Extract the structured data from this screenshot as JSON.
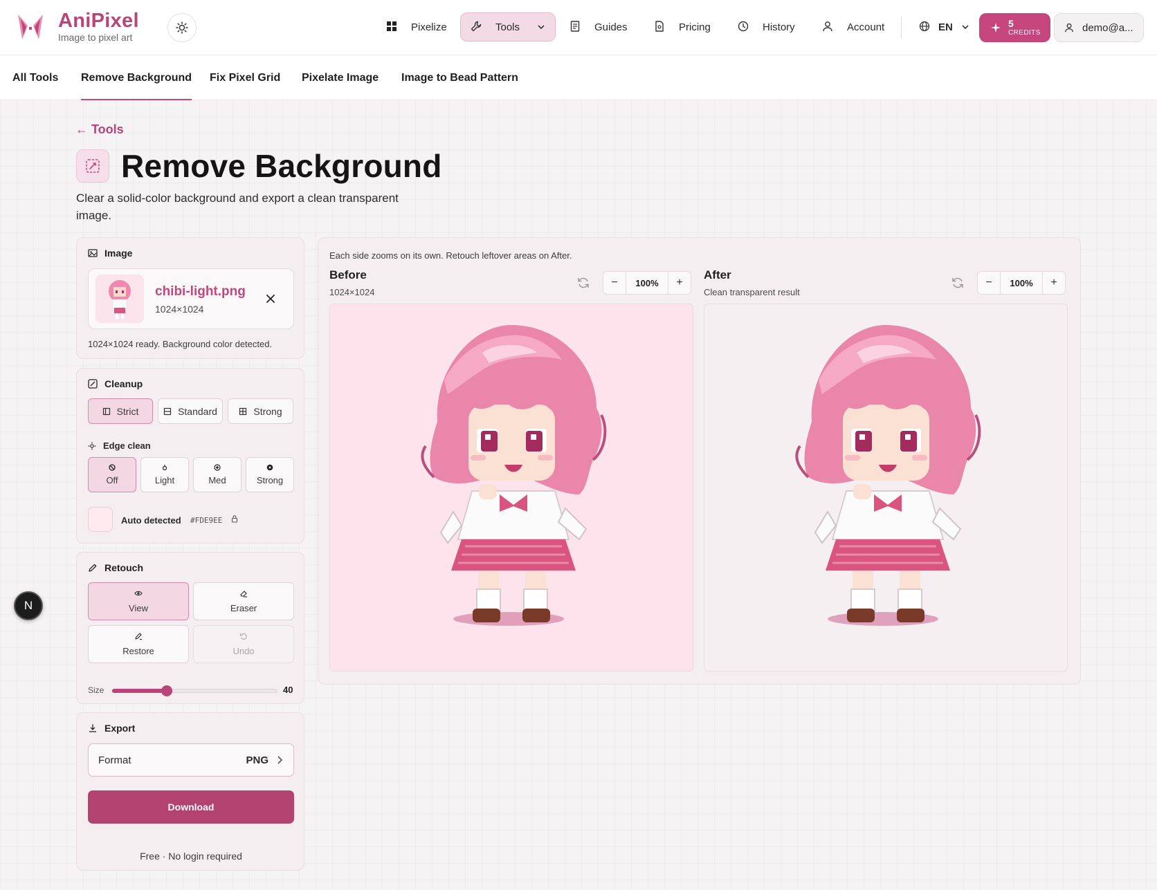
{
  "brand": {
    "name": "AniPixel",
    "tagline": "Image to pixel art"
  },
  "nav": {
    "pixelize": "Pixelize",
    "tools": "Tools",
    "guides": "Guides",
    "pricing": "Pricing",
    "history": "History",
    "account": "Account",
    "language": "EN",
    "credits_count": "5",
    "credits_label": "CREDITS",
    "user": "demo@a..."
  },
  "subnav": [
    "All Tools",
    "Remove Background",
    "Fix Pixel Grid",
    "Pixelate Image",
    "Image to Bead Pattern"
  ],
  "page": {
    "back": "← Tools",
    "title": "Remove Background",
    "description": "Clear a solid-color background and export a clean transparent image."
  },
  "image_panel": {
    "heading": "Image",
    "file_name": "chibi-light.png",
    "file_dims": "1024×1024",
    "status": "1024×1024 ready. Background color detected."
  },
  "cleanup_panel": {
    "heading": "Cleanup",
    "modes": [
      "Strict",
      "Standard",
      "Strong"
    ],
    "active_mode": "Strict",
    "edge_heading": "Edge clean",
    "edge_options": [
      "Off",
      "Light",
      "Med",
      "Strong"
    ],
    "active_edge": "Off",
    "auto_label": "Auto detected",
    "auto_hex": "#FDE9EE"
  },
  "retouch_panel": {
    "heading": "Retouch",
    "view": "View",
    "eraser": "Eraser",
    "restore": "Restore",
    "undo": "Undo",
    "size_label": "Size",
    "size_value": "40",
    "size_fraction": 0.33
  },
  "export_panel": {
    "heading": "Export",
    "format_label": "Format",
    "format_value": "PNG",
    "download": "Download",
    "note": "Free · No login required"
  },
  "preview": {
    "hint": "Each side zooms on its own. Retouch leftover areas on After.",
    "before_title": "Before",
    "before_sub": "1024×1024",
    "before_zoom": "100%",
    "after_title": "After",
    "after_sub": "Clean transparent result",
    "after_zoom": "100%"
  },
  "floating": {
    "avatar_letter": "N"
  },
  "colors": {
    "accent": "#c4467d",
    "accent_dark": "#b2426f",
    "detected_bg": "#FDE9EE"
  }
}
